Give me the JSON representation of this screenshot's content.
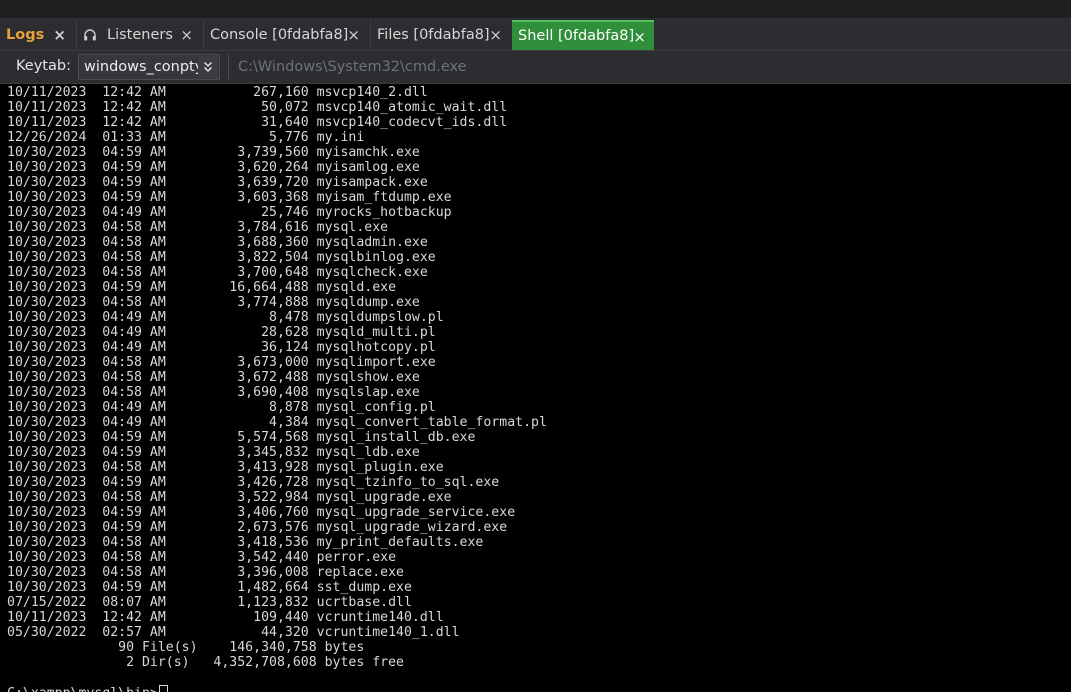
{
  "tabs": [
    {
      "label": "Logs",
      "close_icon": "×"
    },
    {
      "label": "Listeners",
      "icon": "headphones-icon",
      "close_icon": "×"
    },
    {
      "label": "Console [0fdabfa8]",
      "close_icon": "×"
    },
    {
      "label": "Files [0fdabfa8]",
      "close_icon": "×"
    },
    {
      "label": "Shell [0fdabfa8]",
      "close_icon": "×",
      "active": true
    }
  ],
  "toolbar": {
    "keytab_label": "Keytab:",
    "keytab_value": "windows_conpty",
    "path": "C:\\Windows\\System32\\cmd.exe"
  },
  "colors": {
    "logs_tab": "#e8a23a",
    "active_tab": "#2f8f3a",
    "terminal_bg": "#000000",
    "terminal_text": "#d8d8d8"
  },
  "terminal": {
    "lines": [
      "10/11/2023  12:42 AM           267,160 msvcp140_2.dll",
      "10/11/2023  12:42 AM            50,072 msvcp140_atomic_wait.dll",
      "10/11/2023  12:42 AM            31,640 msvcp140_codecvt_ids.dll",
      "12/26/2024  01:33 AM             5,776 my.ini",
      "10/30/2023  04:59 AM         3,739,560 myisamchk.exe",
      "10/30/2023  04:59 AM         3,620,264 myisamlog.exe",
      "10/30/2023  04:59 AM         3,639,720 myisampack.exe",
      "10/30/2023  04:59 AM         3,603,368 myisam_ftdump.exe",
      "10/30/2023  04:49 AM            25,746 myrocks_hotbackup",
      "10/30/2023  04:58 AM         3,784,616 mysql.exe",
      "10/30/2023  04:58 AM         3,688,360 mysqladmin.exe",
      "10/30/2023  04:58 AM         3,822,504 mysqlbinlog.exe",
      "10/30/2023  04:58 AM         3,700,648 mysqlcheck.exe",
      "10/30/2023  04:59 AM        16,664,488 mysqld.exe",
      "10/30/2023  04:58 AM         3,774,888 mysqldump.exe",
      "10/30/2023  04:49 AM             8,478 mysqldumpslow.pl",
      "10/30/2023  04:49 AM            28,628 mysqld_multi.pl",
      "10/30/2023  04:49 AM            36,124 mysqlhotcopy.pl",
      "10/30/2023  04:58 AM         3,673,000 mysqlimport.exe",
      "10/30/2023  04:58 AM         3,672,488 mysqlshow.exe",
      "10/30/2023  04:58 AM         3,690,408 mysqlslap.exe",
      "10/30/2023  04:49 AM             8,878 mysql_config.pl",
      "10/30/2023  04:49 AM             4,384 mysql_convert_table_format.pl",
      "10/30/2023  04:59 AM         5,574,568 mysql_install_db.exe",
      "10/30/2023  04:59 AM         3,345,832 mysql_ldb.exe",
      "10/30/2023  04:58 AM         3,413,928 mysql_plugin.exe",
      "10/30/2023  04:59 AM         3,426,728 mysql_tzinfo_to_sql.exe",
      "10/30/2023  04:58 AM         3,522,984 mysql_upgrade.exe",
      "10/30/2023  04:59 AM         3,406,760 mysql_upgrade_service.exe",
      "10/30/2023  04:59 AM         2,673,576 mysql_upgrade_wizard.exe",
      "10/30/2023  04:58 AM         3,418,536 my_print_defaults.exe",
      "10/30/2023  04:58 AM         3,542,440 perror.exe",
      "10/30/2023  04:58 AM         3,396,008 replace.exe",
      "10/30/2023  04:59 AM         1,482,664 sst_dump.exe",
      "07/15/2022  08:07 AM         1,123,832 ucrtbase.dll",
      "10/11/2023  12:42 AM           109,440 vcruntime140.dll",
      "05/30/2022  02:57 AM            44,320 vcruntime140_1.dll",
      "              90 File(s)    146,340,758 bytes",
      "               2 Dir(s)   4,352,708,608 bytes free"
    ],
    "prompt": "C:\\xampp\\mysql\\bin>"
  }
}
